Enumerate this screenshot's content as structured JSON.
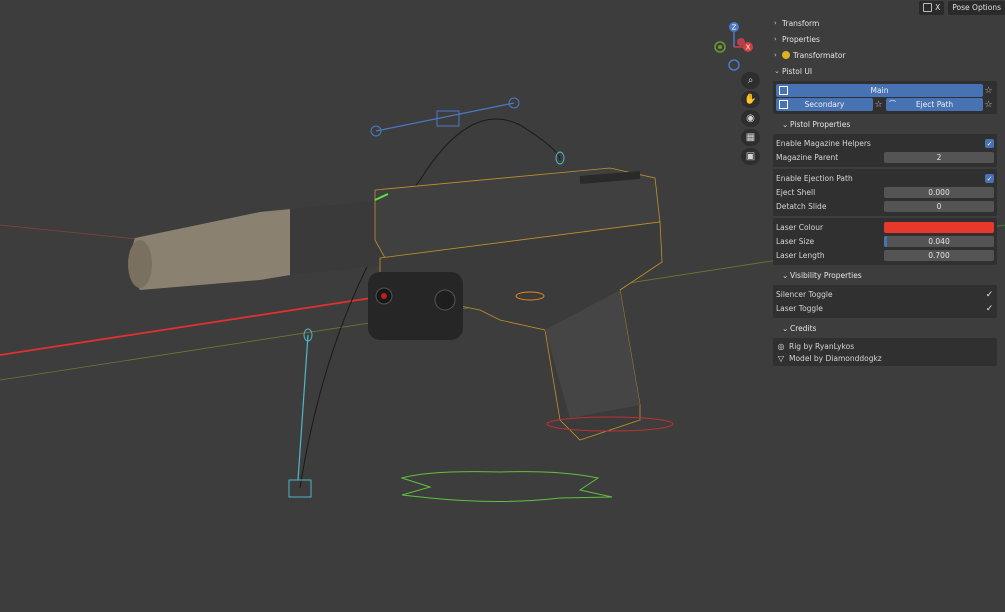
{
  "topbar": {
    "close_label": "X",
    "pose_options_label": "Pose Options"
  },
  "gizmo": {
    "z_label": "Z",
    "x_label": "X",
    "y_label": "Y"
  },
  "nav_tools": [
    "zoom-icon",
    "hand-icon",
    "camera-icon",
    "grid-icon",
    "toggle-view-icon"
  ],
  "sections": {
    "transform": "Transform",
    "properties": "Properties",
    "transformator": "Transformator",
    "pistol_ui": "Pistol UI"
  },
  "pistol_ui": {
    "main_label": "Main",
    "secondary_label": "Secondary",
    "eject_path_label": "Eject Path",
    "pistol_properties_label": "Pistol Properties",
    "enable_magazine_helpers_label": "Enable Magazine Helpers",
    "enable_magazine_helpers": true,
    "magazine_parent_label": "Magazine Parent",
    "magazine_parent_value": "2",
    "enable_ejection_path_label": "Enable Ejection Path",
    "enable_ejection_path": true,
    "eject_shell_label": "Eject Shell",
    "eject_shell_value": "0.000",
    "detatch_slide_label": "Detatch Slide",
    "detatch_slide_value": "0",
    "laser_colour_label": "Laser Colour",
    "laser_colour": "#e8372b",
    "laser_size_label": "Laser Size",
    "laser_size_value": "0.040",
    "laser_length_label": "Laser Length",
    "laser_length_value": "0.700",
    "visibility_properties_label": "Visibility Properties",
    "silencer_toggle_label": "Silencer Toggle",
    "silencer_toggle": true,
    "laser_toggle_label": "Laser Toggle",
    "laser_toggle": true,
    "credits_label": "Credits",
    "rig_credit": "Rig by RyanLykos",
    "model_credit": "Model by Diamonddogkz"
  },
  "colors": {
    "accent": "#4772b3",
    "laser": "#e8372b",
    "panel_bg": "#303030",
    "viewport_bg": "#3d3d3d"
  }
}
